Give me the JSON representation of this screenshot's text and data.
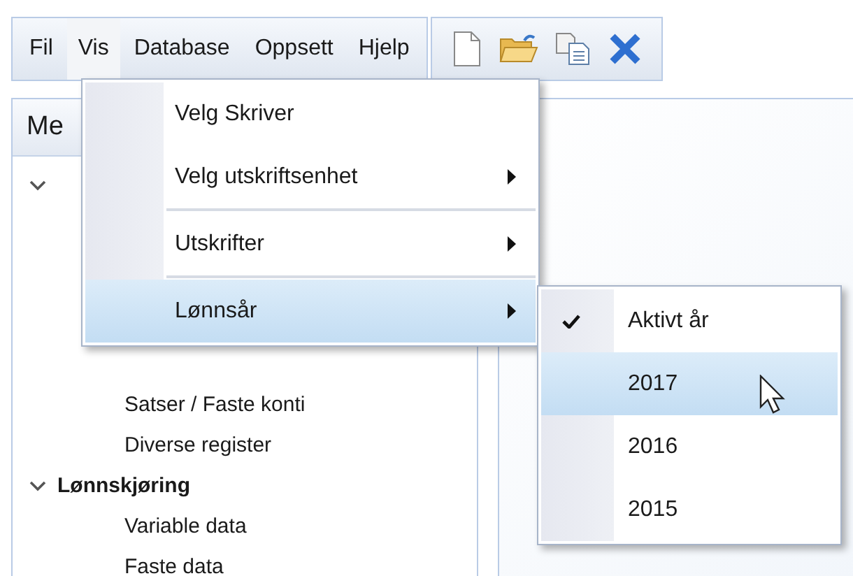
{
  "menubar": [
    {
      "label": "Fil",
      "selected": false
    },
    {
      "label": "Vis",
      "selected": true
    },
    {
      "label": "Database",
      "selected": false
    },
    {
      "label": "Oppsett",
      "selected": false
    },
    {
      "label": "Hjelp",
      "selected": false
    }
  ],
  "toolbar": [
    {
      "kind": "new"
    },
    {
      "kind": "open"
    },
    {
      "kind": "copy"
    },
    {
      "kind": "delete"
    }
  ],
  "left_panel": {
    "header": "Me",
    "tree": [
      {
        "expanded": true,
        "children": [
          {
            "label": "Satser / Faste konti"
          },
          {
            "label": "Diverse register"
          }
        ]
      },
      {
        "label": "Lønnskjøring",
        "expanded": true,
        "children": [
          {
            "label": "Variable data"
          },
          {
            "label": "Faste data"
          }
        ]
      }
    ]
  },
  "menu": [
    {
      "kind": "item",
      "label": "Velg Skriver",
      "submenu": false,
      "selected": false
    },
    {
      "kind": "item",
      "label": "Velg utskriftsenhet",
      "submenu": true,
      "selected": false
    },
    {
      "kind": "separator"
    },
    {
      "kind": "item",
      "label": "Utskrifter",
      "submenu": true,
      "selected": false
    },
    {
      "kind": "separator"
    },
    {
      "kind": "item",
      "label": "Lønnsår",
      "submenu": true,
      "selected": true
    }
  ],
  "submenu": [
    {
      "label": "Aktivt år",
      "checked": true,
      "selected": false
    },
    {
      "label": "2017",
      "checked": false,
      "selected": true
    },
    {
      "label": "2016",
      "checked": false,
      "selected": false
    },
    {
      "label": "2015",
      "checked": false,
      "selected": false
    }
  ]
}
